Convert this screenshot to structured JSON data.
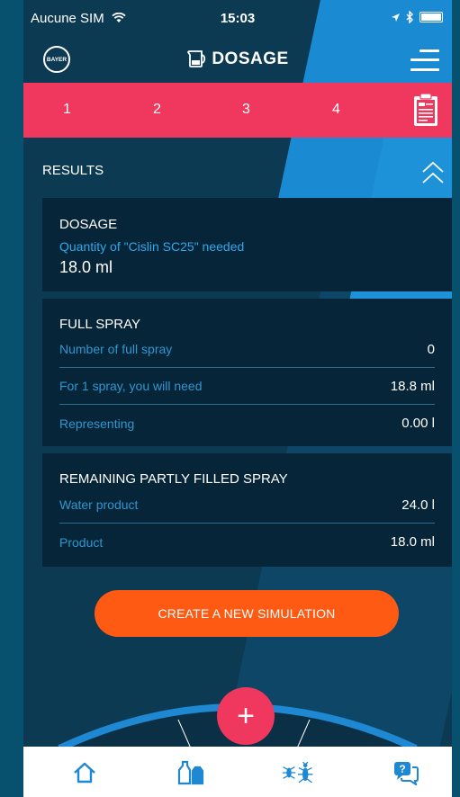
{
  "status_bar": {
    "carrier": "Aucune SIM",
    "time": "15:03"
  },
  "header": {
    "title": "DOSAGE",
    "logo_text": "BAYER"
  },
  "steps": [
    "1",
    "2",
    "3",
    "4"
  ],
  "results": {
    "title": "RESULTS"
  },
  "dosage_card": {
    "title": "DOSAGE",
    "subtitle": "Quantity of \"Cislin SC25\" needed",
    "value": "18.0 ml"
  },
  "full_spray_card": {
    "title": "FULL SPRAY",
    "rows": [
      {
        "label": "Number of full spray",
        "value": "0"
      },
      {
        "label": "For 1 spray, you will need",
        "value": "18.8 ml"
      },
      {
        "label": "Representing",
        "value": "0.00 l"
      }
    ]
  },
  "remaining_card": {
    "title": "REMAINING PARTLY FILLED SPRAY",
    "rows": [
      {
        "label": "Water product",
        "value": "24.0 l"
      },
      {
        "label": "Product",
        "value": "18.0 ml"
      }
    ]
  },
  "cta": {
    "label": "CREATE A NEW SIMULATION"
  },
  "fab": {
    "label": "+"
  },
  "bottom_nav": {
    "items": [
      {
        "icon": "home-icon"
      },
      {
        "icon": "bottles-icon"
      },
      {
        "icon": "insects-icon"
      },
      {
        "icon": "chat-help-icon"
      }
    ]
  },
  "colors": {
    "accent_pink": "#f0385e",
    "cta_orange": "#fe5a13",
    "link_blue": "#2f96cf",
    "nav_blue": "#1e88d2"
  }
}
